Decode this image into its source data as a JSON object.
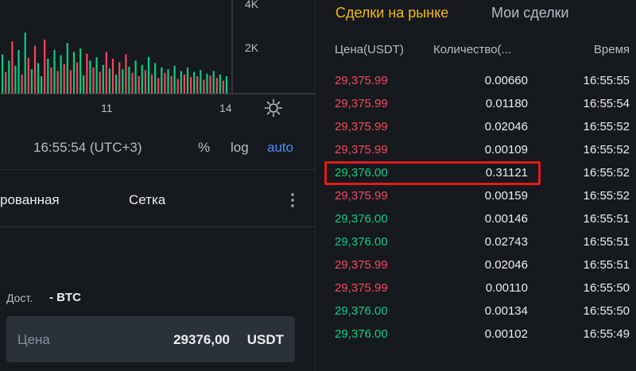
{
  "chart": {
    "y_axis_labels": [
      "4K",
      "2K"
    ],
    "x_axis_labels": [
      "11",
      "14"
    ],
    "time": "16:55:54 (UTC+3)",
    "options": [
      "%",
      "log",
      "auto"
    ],
    "active_option": "auto",
    "bars": [
      [
        0.45,
        "g"
      ],
      [
        0.25,
        "r"
      ],
      [
        0.38,
        "g"
      ],
      [
        0.6,
        "r"
      ],
      [
        0.32,
        "g"
      ],
      [
        0.5,
        "g"
      ],
      [
        0.22,
        "r"
      ],
      [
        0.7,
        "g"
      ],
      [
        0.41,
        "r"
      ],
      [
        0.28,
        "g"
      ],
      [
        0.55,
        "r"
      ],
      [
        0.35,
        "g"
      ],
      [
        0.2,
        "g"
      ],
      [
        0.62,
        "r"
      ],
      [
        0.4,
        "g"
      ],
      [
        0.3,
        "r"
      ],
      [
        0.5,
        "g"
      ],
      [
        0.26,
        "r"
      ],
      [
        0.44,
        "g"
      ],
      [
        0.34,
        "r"
      ],
      [
        0.58,
        "g"
      ],
      [
        0.27,
        "r"
      ],
      [
        0.48,
        "g"
      ],
      [
        0.36,
        "r"
      ],
      [
        0.52,
        "g"
      ],
      [
        0.21,
        "g"
      ],
      [
        0.46,
        "r"
      ],
      [
        0.38,
        "g"
      ],
      [
        0.3,
        "r"
      ],
      [
        0.42,
        "g"
      ],
      [
        0.25,
        "r"
      ],
      [
        0.33,
        "g"
      ],
      [
        0.48,
        "r"
      ],
      [
        0.29,
        "g"
      ],
      [
        0.4,
        "r"
      ],
      [
        0.22,
        "g"
      ],
      [
        0.36,
        "r"
      ],
      [
        0.28,
        "g"
      ],
      [
        0.45,
        "r"
      ],
      [
        0.31,
        "g"
      ],
      [
        0.24,
        "r"
      ],
      [
        0.38,
        "g"
      ],
      [
        0.2,
        "r"
      ],
      [
        0.33,
        "g"
      ],
      [
        0.27,
        "r"
      ],
      [
        0.42,
        "g"
      ],
      [
        0.22,
        "r"
      ],
      [
        0.35,
        "g"
      ],
      [
        0.18,
        "r"
      ],
      [
        0.3,
        "g"
      ],
      [
        0.24,
        "r"
      ],
      [
        0.28,
        "g"
      ],
      [
        0.2,
        "r"
      ],
      [
        0.32,
        "g"
      ],
      [
        0.17,
        "r"
      ],
      [
        0.26,
        "g"
      ],
      [
        0.22,
        "r"
      ],
      [
        0.3,
        "g"
      ],
      [
        0.19,
        "r"
      ],
      [
        0.25,
        "g"
      ],
      [
        0.2,
        "r"
      ],
      [
        0.27,
        "g"
      ],
      [
        0.16,
        "r"
      ],
      [
        0.23,
        "g"
      ],
      [
        0.21,
        "r"
      ],
      [
        0.26,
        "g"
      ],
      [
        0.18,
        "r"
      ],
      [
        0.22,
        "g"
      ],
      [
        0.15,
        "r"
      ],
      [
        0.2,
        "g"
      ]
    ]
  },
  "lower_tabs": [
    "рованная",
    "Сетка"
  ],
  "order_form": {
    "available_label": "Дост.",
    "available_value": "- BTC",
    "price_label": "Цена",
    "price_value": "29376,00",
    "price_unit": "USDT"
  },
  "trades_panel": {
    "tabs": [
      "Сделки на рынке",
      "Мои сделки"
    ],
    "active_tab": "Сделки на рынке",
    "headers": [
      "Цена(USDT)",
      "Количество(...",
      "Время"
    ],
    "rows": [
      {
        "price": "29,375.99",
        "qty": "0.00660",
        "time": "16:55:55",
        "side": "sell"
      },
      {
        "price": "29,375.99",
        "qty": "0.01180",
        "time": "16:55:54",
        "side": "sell"
      },
      {
        "price": "29,375.99",
        "qty": "0.02046",
        "time": "16:55:52",
        "side": "sell"
      },
      {
        "price": "29,375.99",
        "qty": "0.00109",
        "time": "16:55:52",
        "side": "sell"
      },
      {
        "price": "29,376.00",
        "qty": "0.31121",
        "time": "16:55:52",
        "side": "buy"
      },
      {
        "price": "29,375.99",
        "qty": "0.00159",
        "time": "16:55:52",
        "side": "sell"
      },
      {
        "price": "29,376.00",
        "qty": "0.00146",
        "time": "16:55:51",
        "side": "buy"
      },
      {
        "price": "29,376.00",
        "qty": "0.02743",
        "time": "16:55:51",
        "side": "buy"
      },
      {
        "price": "29,375.99",
        "qty": "0.02046",
        "time": "16:55:51",
        "side": "sell"
      },
      {
        "price": "29,375.99",
        "qty": "0.00110",
        "time": "16:55:50",
        "side": "sell"
      },
      {
        "price": "29,376.00",
        "qty": "0.00134",
        "time": "16:55:50",
        "side": "buy"
      },
      {
        "price": "29,376.00",
        "qty": "0.00102",
        "time": "16:55:49",
        "side": "buy"
      }
    ],
    "highlighted_row": 4
  },
  "colors": {
    "buy": "#0ecb81",
    "sell": "#f6465d",
    "accent": "#f0b90b",
    "link": "#4a8cf7",
    "highlight": "#e21b1b"
  }
}
